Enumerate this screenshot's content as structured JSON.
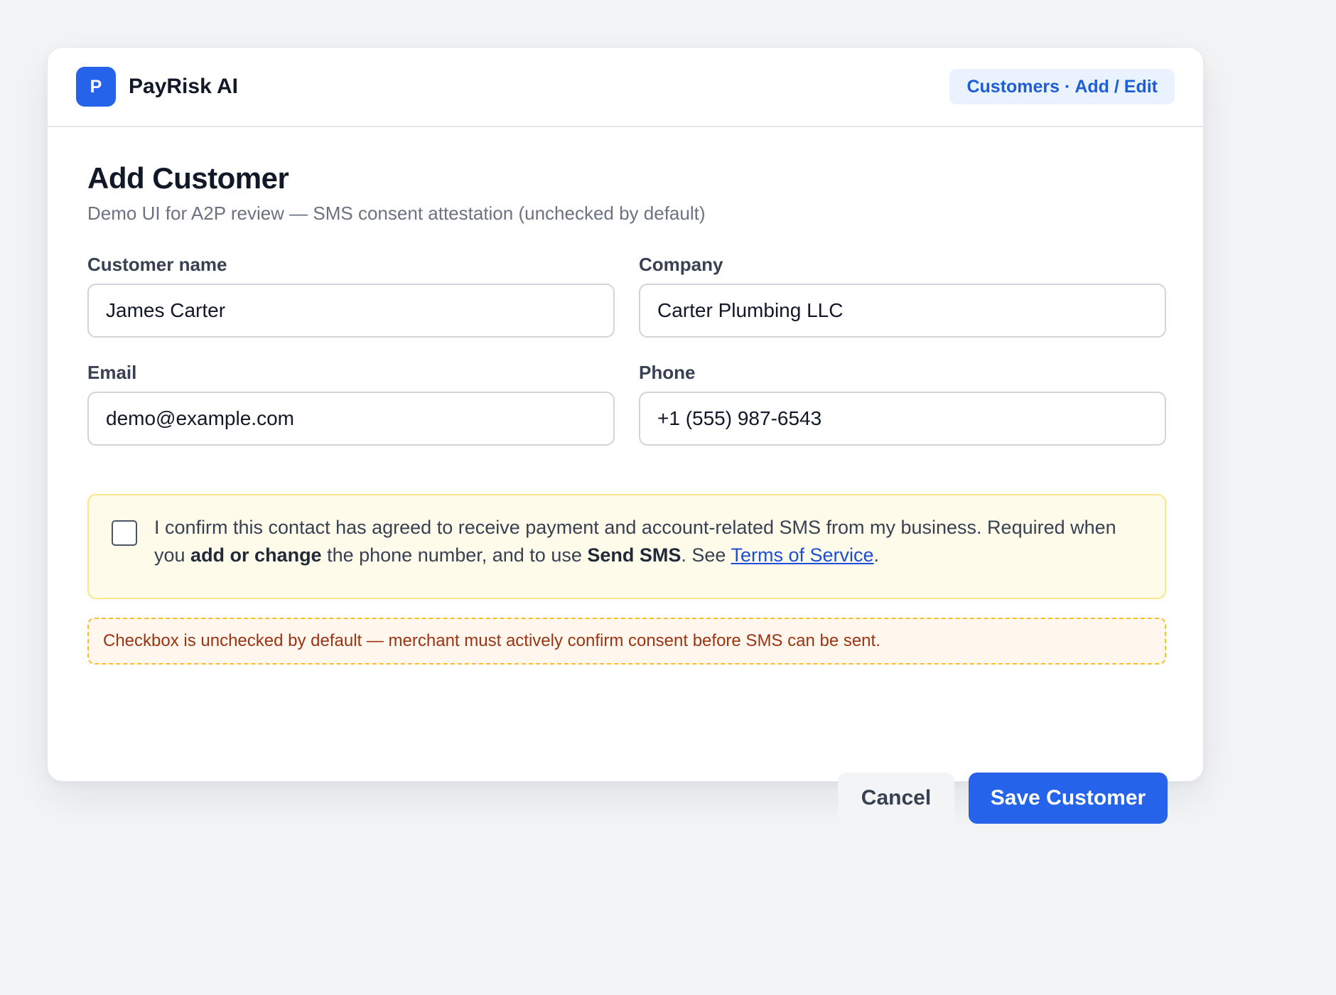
{
  "app": {
    "logo_letter": "P",
    "name": "PayRisk AI",
    "breadcrumb": "Customers · Add / Edit"
  },
  "form": {
    "title": "Add Customer",
    "subtitle": "Demo UI for A2P review — SMS consent attestation (unchecked by default)",
    "fields": {
      "customer_name": {
        "label": "Customer name",
        "value": "James Carter"
      },
      "company": {
        "label": "Company",
        "value": "Carter Plumbing LLC"
      },
      "email": {
        "label": "Email",
        "value": "demo@example.com"
      },
      "phone": {
        "label": "Phone",
        "value": "+1 (555) 987-6543"
      }
    },
    "consent": {
      "checked": false,
      "text_1": "I confirm this contact has agreed to receive payment and account-related SMS from my business. Required when you ",
      "bold_1": "add or change",
      "text_2": " the phone number, and to use ",
      "bold_2": "Send SMS",
      "text_3": ". See ",
      "link": "Terms of Service",
      "text_4": "."
    },
    "notice": "Checkbox is unchecked by default — merchant must actively confirm consent before SMS can be sent.",
    "buttons": {
      "cancel": "Cancel",
      "save": "Save Customer"
    }
  },
  "colors": {
    "background": "#f3f4f6",
    "accent": "#2563eb",
    "consent_bg": "#fefbea",
    "consent_border": "#fde68a",
    "notice_bg": "#fff7ed",
    "notice_text": "#9a3412"
  }
}
